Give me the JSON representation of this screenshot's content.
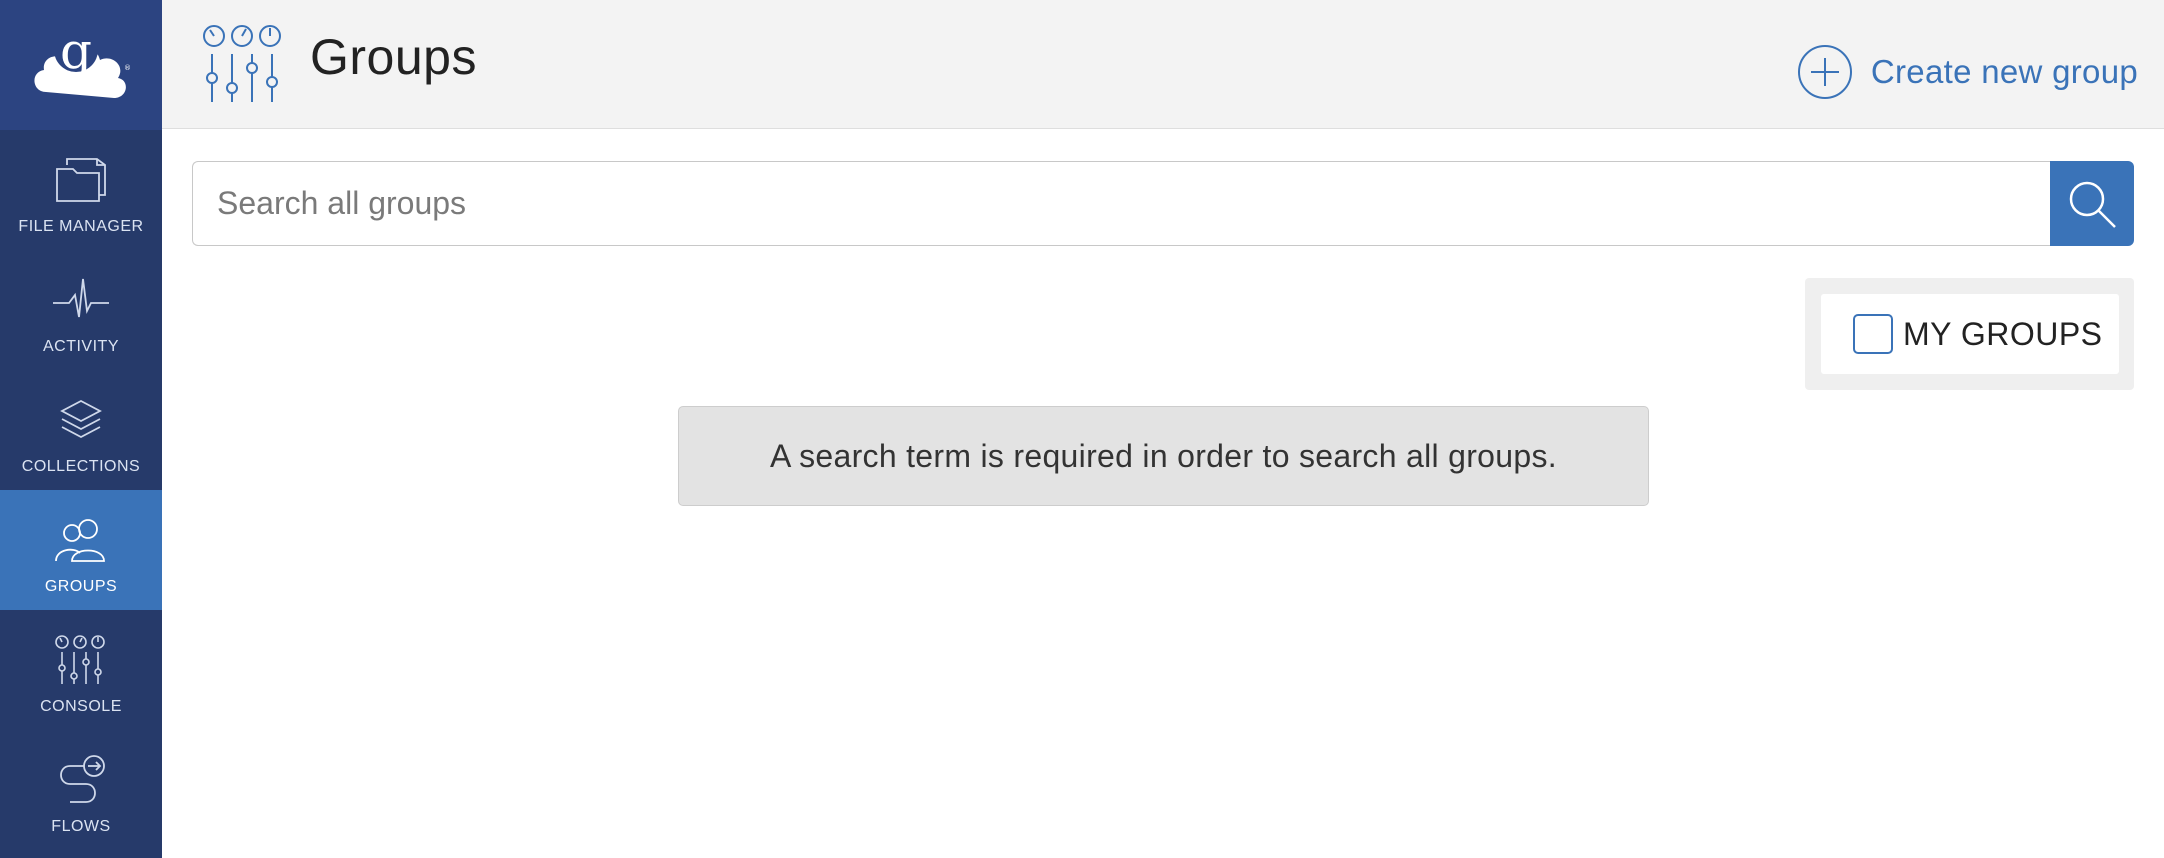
{
  "sidebar": {
    "logo_icon": "globus-cloud-logo",
    "items": [
      {
        "label": "FILE MANAGER",
        "icon": "folder-icon",
        "active": false
      },
      {
        "label": "ACTIVITY",
        "icon": "pulse-icon",
        "active": false
      },
      {
        "label": "COLLECTIONS",
        "icon": "layers-icon",
        "active": false
      },
      {
        "label": "GROUPS",
        "icon": "users-icon",
        "active": true
      },
      {
        "label": "CONSOLE",
        "icon": "sliders-icon",
        "active": false
      },
      {
        "label": "FLOWS",
        "icon": "flow-icon",
        "active": false
      }
    ]
  },
  "header": {
    "title": "Groups",
    "icon": "sliders-gauge-icon",
    "create_label": "Create new group",
    "create_icon": "plus-circle-icon"
  },
  "search": {
    "placeholder": "Search all groups",
    "value": "",
    "button_icon": "search-icon"
  },
  "filter": {
    "my_groups_label": "MY GROUPS",
    "my_groups_checked": false
  },
  "notice": {
    "text": "A search term is required in order to search all groups."
  },
  "colors": {
    "sidebar_bg": "#263a6a",
    "logo_bg": "#2c4481",
    "accent": "#3a73b8",
    "header_bg": "#f3f3f3",
    "notice_bg": "#e3e3e3"
  }
}
